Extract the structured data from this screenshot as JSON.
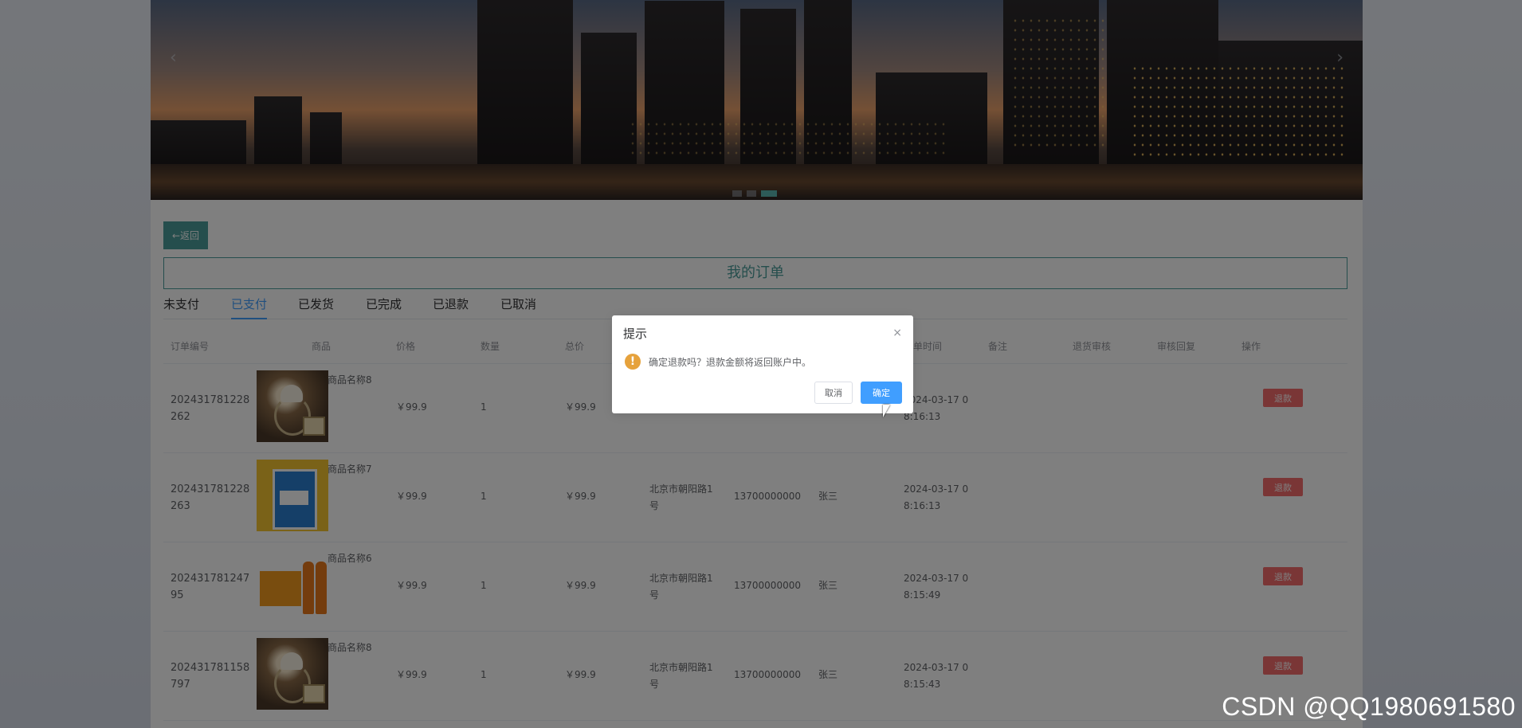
{
  "banner": {
    "prev_icon": "chevron-left-icon",
    "next_icon": "chevron-right-icon",
    "prev_glyph": "‹",
    "next_glyph": "›"
  },
  "back_button": {
    "label": "←返回"
  },
  "page_title": "我的订单",
  "tabs": [
    {
      "label": "未支付",
      "active": false
    },
    {
      "label": "已支付",
      "active": true
    },
    {
      "label": "已发货",
      "active": false
    },
    {
      "label": "已完成",
      "active": false
    },
    {
      "label": "已退款",
      "active": false
    },
    {
      "label": "已取消",
      "active": false
    }
  ],
  "table": {
    "headers": [
      "订单编号",
      "商品",
      "价格",
      "数量",
      "总价",
      "下单时间",
      "备注",
      "退货审核",
      "审核回复",
      "操作"
    ],
    "rows": [
      {
        "order_no_1": "202431781228",
        "order_no_2": "262",
        "product": "商品名称8",
        "image": "lamp",
        "price": "￥99.9",
        "qty": "1",
        "total": "￥99.9",
        "address_1": "",
        "address_2": "号",
        "phone": "",
        "name": "",
        "time_1": "2024-03-17 0",
        "time_2": "8:16:13",
        "action": "退款"
      },
      {
        "order_no_1": "202431781228",
        "order_no_2": "263",
        "product": "商品名称7",
        "image": "box",
        "price": "￥99.9",
        "qty": "1",
        "total": "￥99.9",
        "address_1": "北京市朝阳路1",
        "address_2": "号",
        "phone": "13700000000",
        "name": "张三",
        "time_1": "2024-03-17 0",
        "time_2": "8:16:13",
        "action": "退款"
      },
      {
        "order_no_1": "202431781247",
        "order_no_2": "95",
        "product": "商品名称6",
        "image": "juice",
        "price": "￥99.9",
        "qty": "1",
        "total": "￥99.9",
        "address_1": "北京市朝阳路1",
        "address_2": "号",
        "phone": "13700000000",
        "name": "张三",
        "time_1": "2024-03-17 0",
        "time_2": "8:15:49",
        "action": "退款"
      },
      {
        "order_no_1": "202431781158",
        "order_no_2": "797",
        "product": "商品名称8",
        "image": "lamp",
        "price": "￥99.9",
        "qty": "1",
        "total": "￥99.9",
        "address_1": "北京市朝阳路1",
        "address_2": "号",
        "phone": "13700000000",
        "name": "张三",
        "time_1": "2024-03-17 0",
        "time_2": "8:15:43",
        "action": "退款"
      }
    ]
  },
  "dialog": {
    "title": "提示",
    "message": "确定退款吗？退款金额将返回账户中。",
    "cancel": "取消",
    "confirm": "确定",
    "close_icon": "close-icon",
    "close_glyph": "×",
    "warning_icon": "warning-icon",
    "warning_glyph": "!"
  },
  "watermark": "CSDN @QQ1980691580",
  "colors": {
    "accent": "#4a9d9a",
    "primary": "#409eff",
    "danger": "#f56c6c",
    "warning": "#e6a23c"
  }
}
